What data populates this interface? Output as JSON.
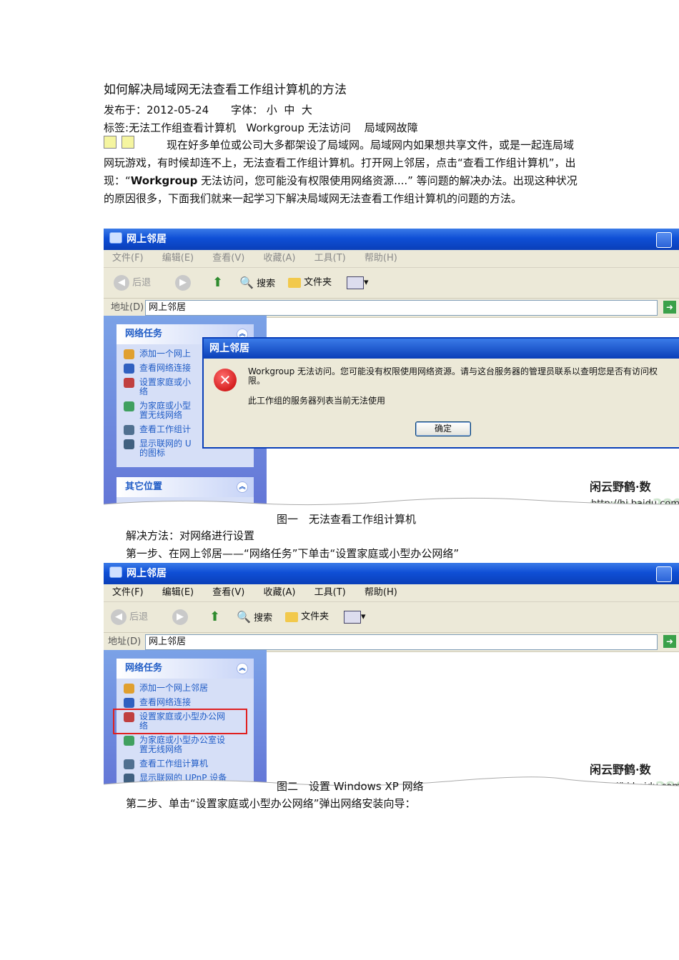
{
  "article": {
    "title": "如何解决局域网无法查看工作组计算机的方法",
    "meta_date": "发布于：2012-05-24",
    "meta_font_label": "字体：",
    "meta_font_sizes": [
      "小",
      "中",
      "大"
    ],
    "tags_label": "标签:",
    "tags": [
      "无法工作组查看计算机",
      "Workgroup 无法访问",
      "局域网故障"
    ],
    "intro_part1": "现在好多单位或公司大多都架设了局域网。局域网内如果想共享文件，或是一起连局域网玩游戏，有时候却连不上，无法查看工作组计算机。打开网上邻居，点击“查看工作组计算机”，出现：“",
    "intro_bold": "Workgroup",
    "intro_part2": " 无法访问，您可能没有权限使用网络资源....” 等问题的解决办法。出现这种状况的原因很多，下面我们就来一起学习下解决局域网无法查看工作组计算机的问题的方法。",
    "figure1_caption": "图一　无法查看工作组计算机",
    "solution_label": "解决方法：对网络进行设置",
    "step1": "第一步、在网上邻居——“网络任务”下单击“设置家庭或小型办公网络”",
    "figure2_caption": "图二　设置 Windows XP 网络",
    "step2": "第二步、单击“设置家庭或小型办公网络”弹出网络安装向导："
  },
  "window": {
    "title": "网上邻居",
    "menu": [
      "文件(F)",
      "编辑(E)",
      "查看(V)",
      "收藏(A)",
      "工具(T)",
      "帮助(H)"
    ],
    "back_label": "后退",
    "search_label": "搜索",
    "folders_label": "文件夹",
    "address_label": "地址(D)",
    "address_value": "网上邻居",
    "network_tasks_header": "网络任务",
    "other_places_header": "其它位置",
    "tasks_fig1": [
      "添加一个网上",
      "查看网络连接",
      "设置家庭或小\n络",
      "为家庭或小型\n置无线网络",
      "查看工作组计",
      "显示联网的 U\n的图标"
    ],
    "tasks_fig2": [
      "添加一个网上邻居",
      "查看网络连接",
      "设置家庭或小型办公网\n络",
      "为家庭或小型办公室设\n置无线网络",
      "查看工作组计算机",
      "显示联网的 UPnP 设备"
    ]
  },
  "dialog": {
    "title": "网上邻居",
    "message1": "Workgroup 无法访问。您可能没有权限使用网络资源。请与这台服务器的管理员联系以查明您是否有访问权\n限。",
    "message2": "此工作组的服务器列表当前无法使用",
    "ok_label": "确定"
  },
  "watermark": {
    "name": "闲云野鹤·数",
    "url": "http://hi.baidu.com/",
    "site": "www.pc280.c"
  },
  "colors": {
    "xp_title_blue": "#0f4fd6",
    "task_link_blue": "#215dc6",
    "highlight_red": "#e02020",
    "error_red": "#c30000"
  }
}
